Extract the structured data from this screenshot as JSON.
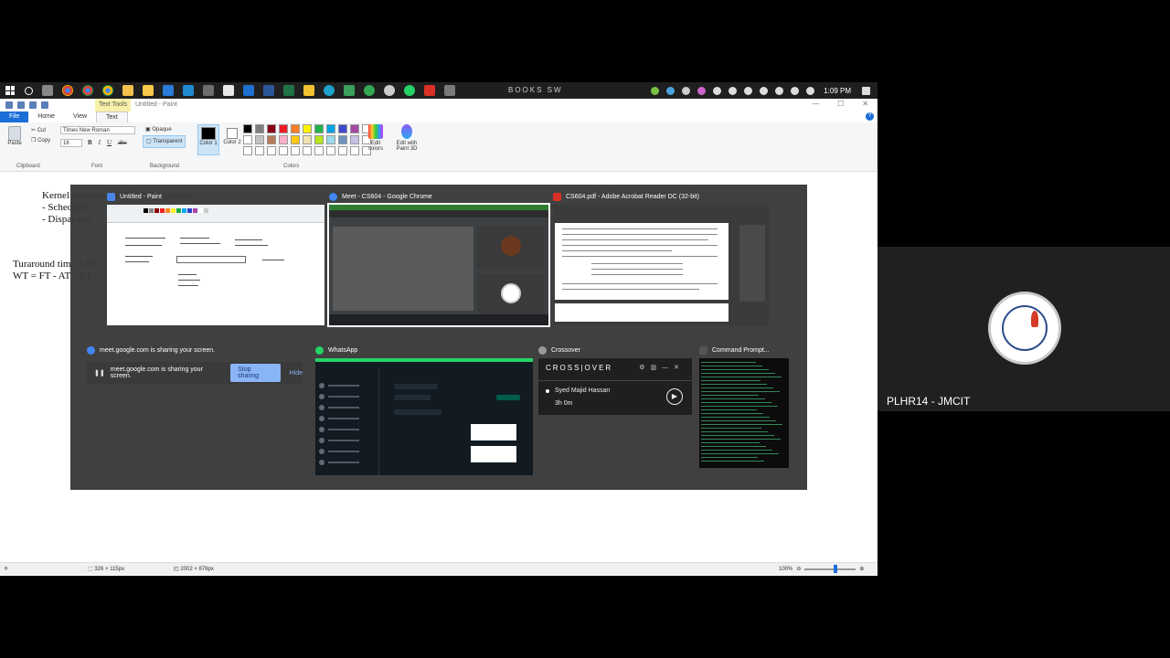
{
  "taskbar": {
    "center_label": "BOOKS  SW",
    "clock": "1:09 PM",
    "icons": [
      "windows-logo",
      "search-icon",
      "task-view-icon",
      "chrome-icon",
      "chrome-alt-icon",
      "chrome-alt2-icon",
      "paint-icon",
      "file-explorer-icon",
      "store-icon",
      "vscode-icon",
      "app-icon",
      "app-icon",
      "mail-icon",
      "word-icon",
      "excel-icon",
      "notes-icon",
      "edge-icon",
      "app-icon",
      "app-icon",
      "app-icon",
      "whatsapp-icon",
      "acrobat-icon",
      "app-icon"
    ],
    "tray_colors": [
      "#7cc242",
      "#4aa3df",
      "#cccccc",
      "#cc66cc",
      "#dddddd",
      "#dddddd",
      "#dddddd",
      "#dddddd",
      "#dddddd",
      "#dddddd",
      "#dddddd"
    ]
  },
  "paint": {
    "context_tab": "Text Tools",
    "window_name": "Untitled - Paint",
    "menu": {
      "file": "File",
      "home": "Home",
      "view": "View",
      "text": "Text"
    },
    "clipboard": {
      "paste": "Paste",
      "cut": "Cut",
      "copy": "Copy",
      "label": "Clipboard"
    },
    "font": {
      "family": "Times New Roman",
      "size": "16",
      "bold": "B",
      "italic": "I",
      "underline": "U",
      "strike": "abc",
      "label": "Font"
    },
    "background": {
      "opaque": "Opaque",
      "transparent": "Transparent",
      "label": "Background"
    },
    "colors": {
      "color1": "Color 1",
      "color2": "Color 2",
      "edit": "Edit colors",
      "paint3d": "Edit with Paint 3D",
      "label": "Colors",
      "palette": [
        "#000000",
        "#7f7f7f",
        "#880015",
        "#ed1c24",
        "#ff7f27",
        "#fff200",
        "#22b14c",
        "#00a2e8",
        "#3f48cc",
        "#a349a4",
        "#ffffff",
        "#ffffff",
        "#c3c3c3",
        "#b97a57",
        "#ffaec9",
        "#ffc90e",
        "#efe4b0",
        "#b5e61d",
        "#99d9ea",
        "#7092be",
        "#c8bfe7",
        "#ffffff",
        "#ffffff",
        "#ffffff",
        "#ffffff",
        "#ffffff",
        "#ffffff",
        "#ffffff",
        "#ffffff",
        "#ffffff",
        "#ffffff",
        "#ffffff",
        "#ffffff"
      ]
    },
    "canvas_text": [
      "Kernel contains 3 important modules",
      "- Scheduler",
      "- Dispatcher",
      "Turaround time = Ex",
      "WT = FT - AT - BT"
    ],
    "status": {
      "selection": "326 × 115px",
      "canvas": "2002 × 876px",
      "zoom": "100%"
    }
  },
  "alttab": {
    "cards": [
      {
        "title": "Untitled - Paint",
        "icon_color": "#4a86e8"
      },
      {
        "title": "Meet - CS604 - Google Chrome",
        "icon_color": "#4285f4"
      },
      {
        "title": "CS604.pdf - Adobe Acrobat Reader DC (32-bit)",
        "icon_color": "#d93025"
      },
      {
        "title": "meet.google.com is sharing your screen.",
        "icon_color": "#4285f4"
      },
      {
        "title": "WhatsApp",
        "icon_color": "#25d366"
      },
      {
        "title": "Crossover",
        "icon_color": "#999999"
      },
      {
        "title": "Command Prompt...",
        "icon_color": "#555555"
      }
    ],
    "share_banner": {
      "text": "meet.google.com is sharing your screen.",
      "stop": "Stop sharing",
      "hide": "Hide"
    },
    "crossover": {
      "brand": "CROSS|OVER",
      "user": "Syed Majid Hassan",
      "time": "3h 0m"
    }
  },
  "participant": {
    "name": "PLHR14 - JMCIT"
  }
}
